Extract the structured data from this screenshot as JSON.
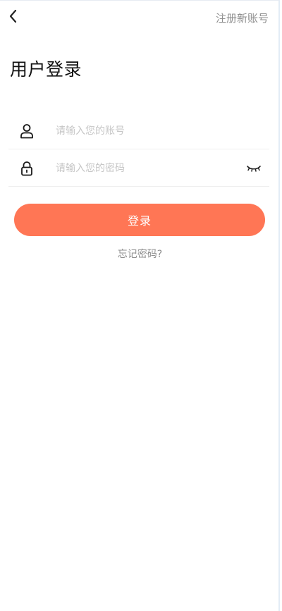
{
  "header": {
    "back_icon": "chevron-left-icon",
    "register_label": "注册新账号"
  },
  "title": "用户登录",
  "form": {
    "account": {
      "icon": "user-icon",
      "value": "",
      "placeholder": "请输入您的账号"
    },
    "password": {
      "icon": "lock-icon",
      "value": "",
      "placeholder": "请输入您的密码",
      "toggle_icon": "eye-closed-icon"
    }
  },
  "actions": {
    "login_label": "登录",
    "forgot_label": "忘记密码?"
  },
  "colors": {
    "accent": "#ff7655",
    "text_primary": "#121212",
    "text_secondary": "#8e8e8e",
    "placeholder": "#c6c6c6"
  }
}
